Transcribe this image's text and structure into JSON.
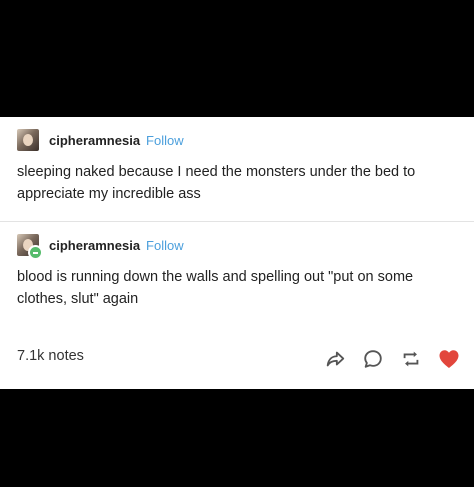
{
  "posts": [
    {
      "username": "cipheramnesia",
      "follow_label": "Follow",
      "text": "sleeping naked because I need the monsters under the bed to appreciate my incredible ass"
    },
    {
      "username": "cipheramnesia",
      "follow_label": "Follow",
      "text": "blood is running down the walls and spelling out \"put on some clothes, slut\" again"
    }
  ],
  "footer": {
    "notes": "7.1k notes",
    "icons": [
      "share-icon",
      "reply-icon",
      "reblog-icon",
      "like-icon"
    ]
  },
  "colors": {
    "follow": "#4b9fdc",
    "like": "#e2463c",
    "badge": "#56bc6c"
  }
}
